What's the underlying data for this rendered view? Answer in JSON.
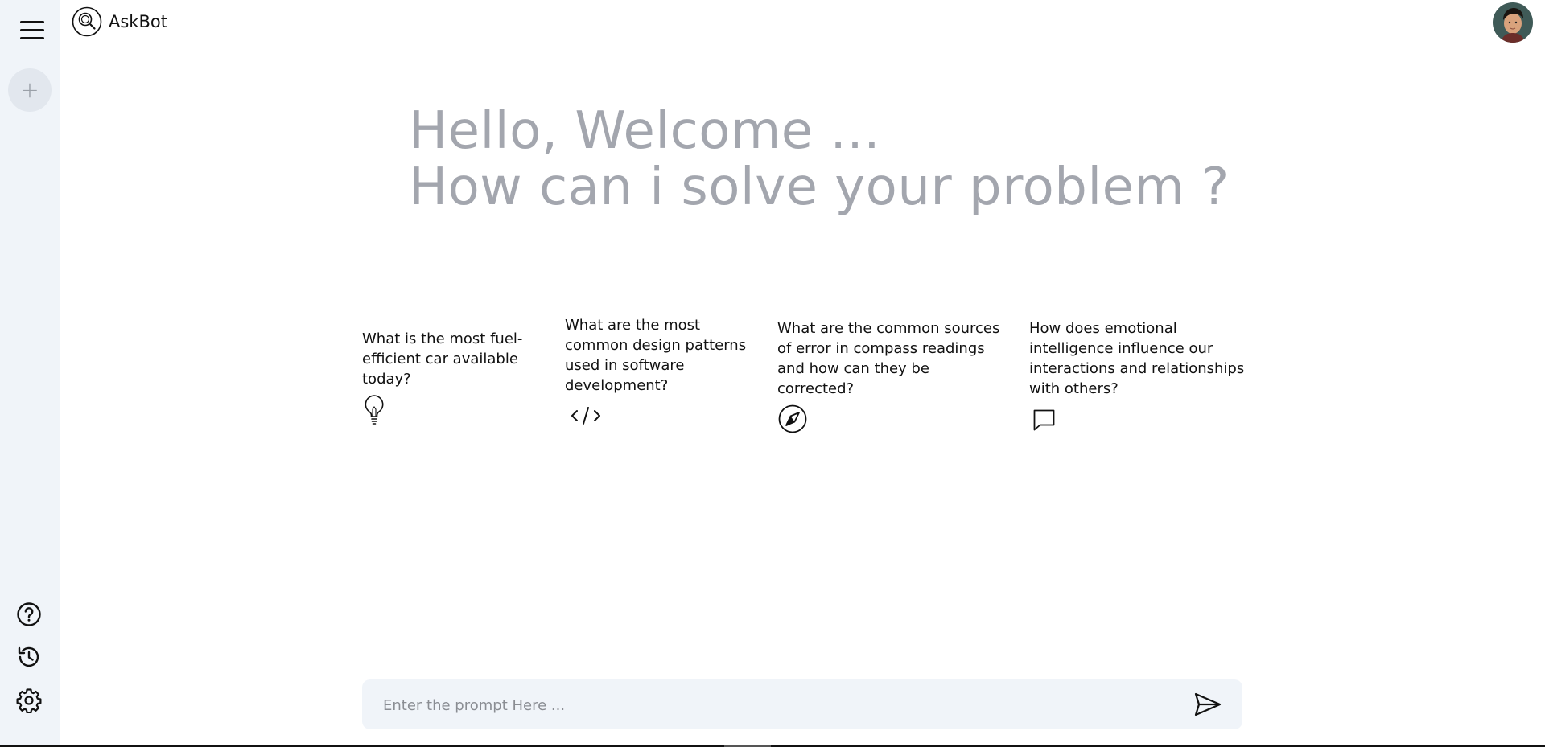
{
  "app": {
    "title": "AskBot"
  },
  "greeting": {
    "line1": "Hello, Welcome ...",
    "line2": "How can i solve your problem ?"
  },
  "cards": [
    {
      "text": "What is the most fuel-efficient car available today?",
      "icon": "lightbulb-icon"
    },
    {
      "text": "What are the most common design patterns used in software development?",
      "icon": "code-icon"
    },
    {
      "text": "What are the common sources of error in compass readings and how can they be corrected?",
      "icon": "compass-icon"
    },
    {
      "text": "How does emotional intelligence influence our interactions and relationships with others?",
      "icon": "chat-icon"
    }
  ],
  "prompt": {
    "placeholder": "Enter the prompt Here ..."
  },
  "sidebar": {
    "new_chat_label": "+",
    "icons": [
      "help-icon",
      "history-icon",
      "settings-icon"
    ]
  },
  "colors": {
    "sidebar_bg": "#f0f4f9",
    "greeting_text": "#a3a6ae",
    "prompt_bg": "#f0f4f9"
  }
}
